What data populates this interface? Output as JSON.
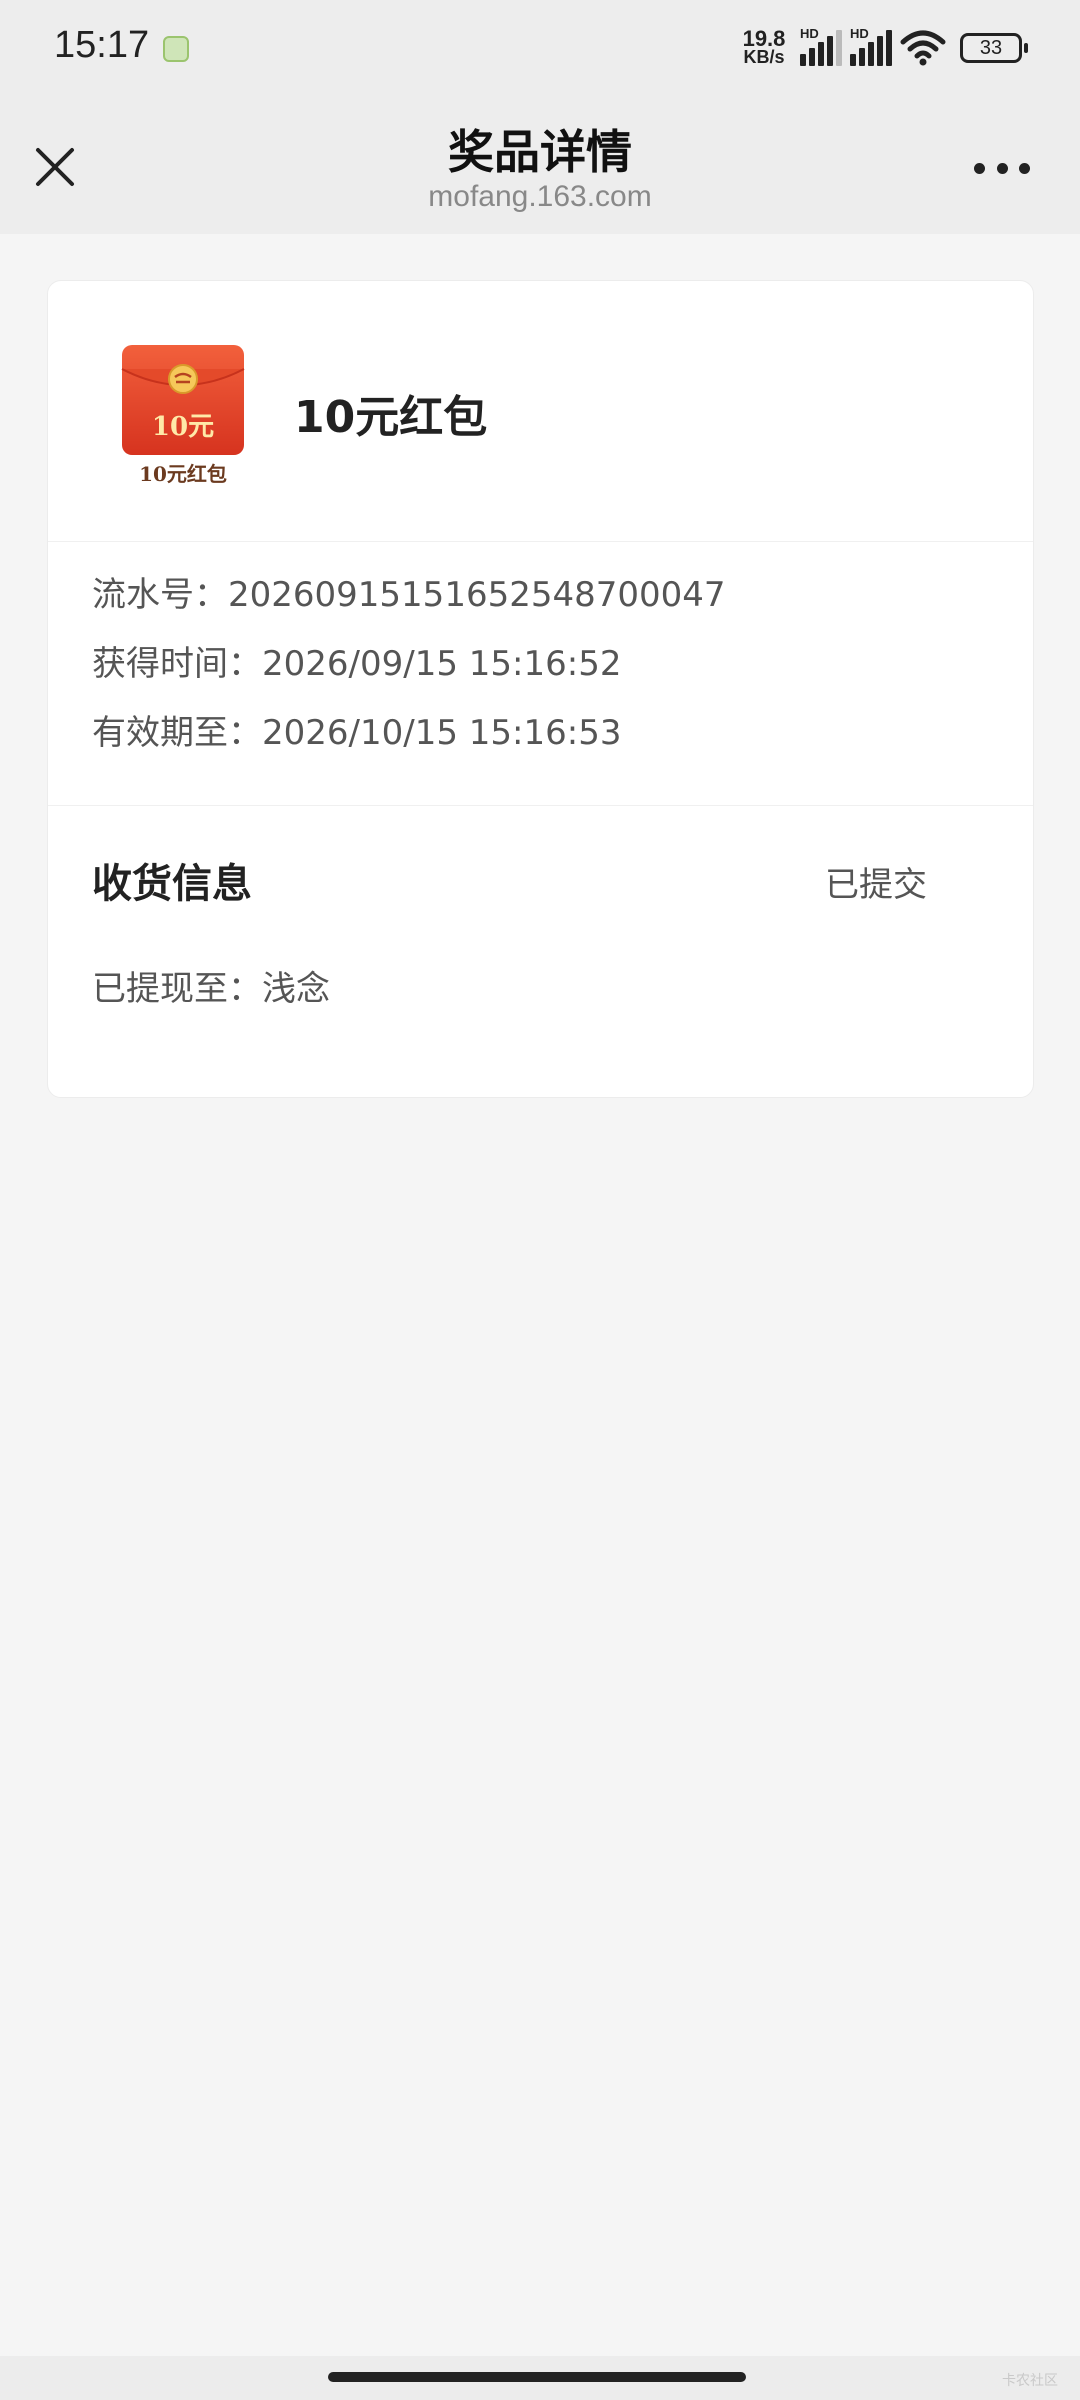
{
  "status_bar": {
    "time": "15:17",
    "net_speed_value": "19.8",
    "net_speed_unit": "KB/s",
    "sim1_label": "HD",
    "sim2_label": "HD",
    "battery": "33"
  },
  "header": {
    "title": "奖品详情",
    "subtitle": "mofang.163.com"
  },
  "prize": {
    "name": "10元红包",
    "image_amount": "10元",
    "image_caption": "10元红包",
    "image_color": "#e8462b"
  },
  "details": [
    {
      "label": "流水号：",
      "value": "20260915151652548700047"
    },
    {
      "label": "获得时间：",
      "value": "2026/09/15 15:16:52"
    },
    {
      "label": "有效期至：",
      "value": "2026/10/15 15:16:53"
    }
  ],
  "shipping": {
    "title": "收货信息",
    "status": "已提交",
    "detail_label": "已提现至：",
    "detail_value": "浅念"
  },
  "watermark": "卡农社区"
}
